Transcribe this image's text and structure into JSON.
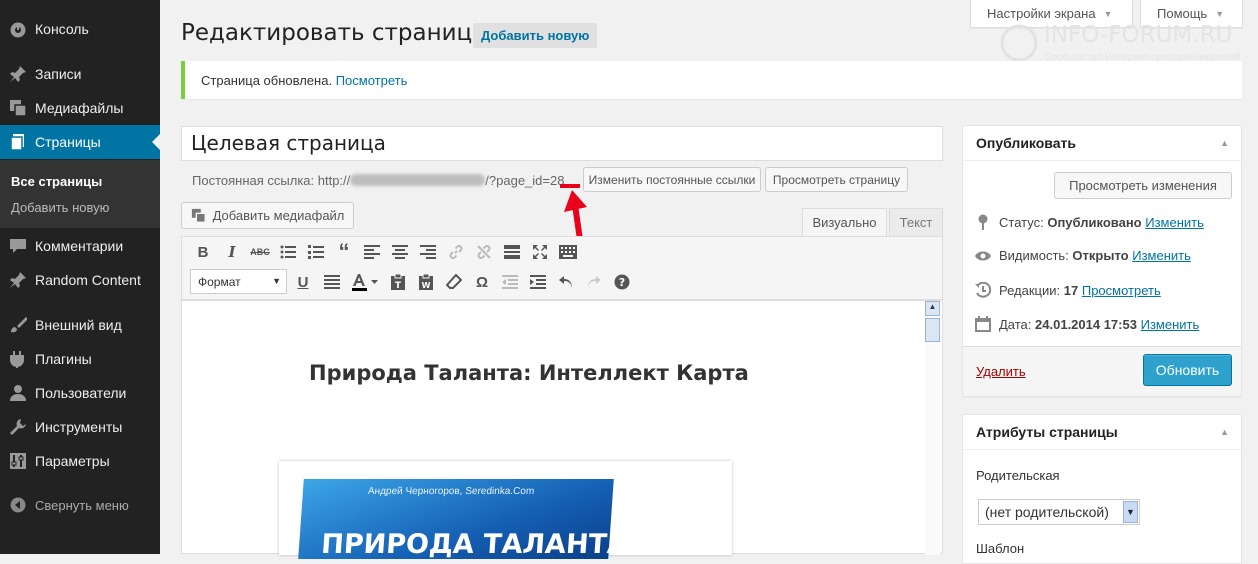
{
  "sidebar": {
    "items": [
      {
        "label": "Консоль",
        "icon": "dashboard-icon"
      },
      {
        "label": "Записи",
        "icon": "pin-icon"
      },
      {
        "label": "Медиафайлы",
        "icon": "media-icon"
      },
      {
        "label": "Страницы",
        "icon": "pages-icon"
      },
      {
        "label": "Комментарии",
        "icon": "comment-icon"
      },
      {
        "label": "Random Content",
        "icon": "pin-icon"
      },
      {
        "label": "Внешний вид",
        "icon": "brush-icon"
      },
      {
        "label": "Плагины",
        "icon": "plugin-icon"
      },
      {
        "label": "Пользователи",
        "icon": "users-icon"
      },
      {
        "label": "Инструменты",
        "icon": "wrench-icon"
      },
      {
        "label": "Параметры",
        "icon": "settings-icon"
      }
    ],
    "submenu": [
      "Все страницы",
      "Добавить новую"
    ],
    "collapse": "Свернуть меню"
  },
  "top": {
    "screen_options": "Настройки экрана",
    "help": "Помощь"
  },
  "watermark": {
    "title": "INFO-FORUM.RU",
    "subtitle": "Сообщество Интернет-предпринимателей"
  },
  "header": {
    "title": "Редактировать страницу",
    "add_new": "Добавить новую"
  },
  "notice": {
    "text": "Страница обновлена.",
    "link": "Посмотреть"
  },
  "editor": {
    "page_title": "Целевая страница",
    "permalink_label": "Постоянная ссылка: http://",
    "permalink_suffix": "/?page_id=28",
    "change_permalink": "Изменить постоянные ссылки",
    "view_page": "Просмотреть страницу",
    "add_media": "Добавить медиафайл",
    "tab_visual": "Визуально",
    "tab_text": "Текст",
    "format": "Формат",
    "heading": "Природа Таланта: Интеллект Карта",
    "book_author": "Андрей Черногоров, Seredinka.Com",
    "book_title": "ПРИРОДА ТАЛАНТА"
  },
  "publish": {
    "title": "Опубликовать",
    "preview": "Просмотреть изменения",
    "status_label": "Статус:",
    "status_value": "Опубликовано",
    "status_link": "Изменить",
    "visibility_label": "Видимость:",
    "visibility_value": "Открыто",
    "visibility_link": "Изменить",
    "revisions_label": "Редакции:",
    "revisions_value": "17",
    "revisions_link": "Просмотреть",
    "date_label": "Дата:",
    "date_value": "24.01.2014 17:53",
    "date_link": "Изменить",
    "delete": "Удалить",
    "update": "Обновить"
  },
  "attributes": {
    "title": "Атрибуты страницы",
    "parent_label": "Родительская",
    "parent_value": "(нет родительской)",
    "template_label": "Шаблон"
  },
  "colors": {
    "accent": "#0074a2",
    "sidebar": "#222222",
    "primary": "#2ea2cc",
    "annotation": "#e8001c"
  }
}
